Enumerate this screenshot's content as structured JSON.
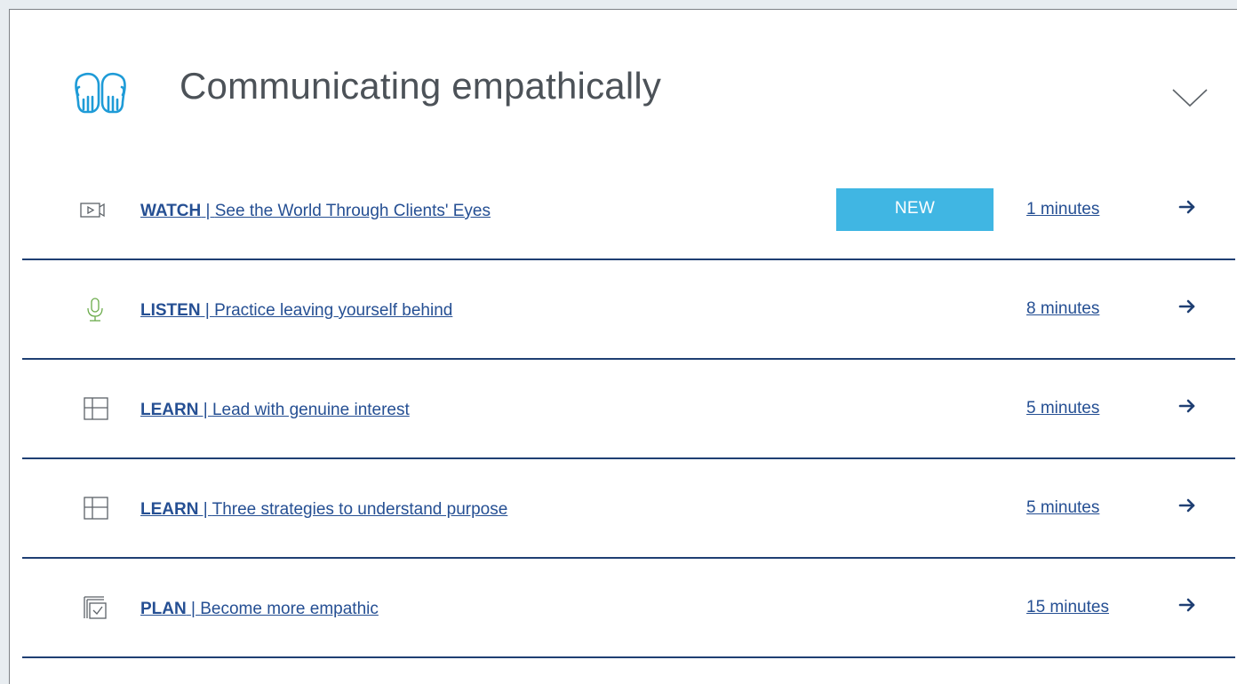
{
  "section": {
    "title": "Communicating empathically",
    "icon": "open-hands-icon",
    "collapse_icon": "chevron-down-icon",
    "accent_color": "#1e9bd7",
    "link_color": "#254f93",
    "badge_color": "#40b6e3",
    "divider_color": "#1f3f73"
  },
  "items": [
    {
      "icon": "video-camera-icon",
      "kind": "WATCH",
      "separator": " | ",
      "title": "See the World Through Clients' Eyes",
      "badge": "NEW",
      "duration": "1 minutes",
      "arrow_icon": "arrow-right-icon"
    },
    {
      "icon": "microphone-icon",
      "kind": "LISTEN",
      "separator": " | ",
      "title": "Practice leaving yourself behind",
      "duration": "8 minutes",
      "arrow_icon": "arrow-right-icon"
    },
    {
      "icon": "layout-grid-icon",
      "kind": "LEARN",
      "separator": " | ",
      "title": "Lead with genuine interest",
      "duration": "5 minutes",
      "arrow_icon": "arrow-right-icon"
    },
    {
      "icon": "layout-grid-icon",
      "kind": "LEARN",
      "separator": " | ",
      "title": "Three strategies to understand purpose",
      "duration": "5 minutes",
      "arrow_icon": "arrow-right-icon"
    },
    {
      "icon": "checklist-icon",
      "kind": "PLAN",
      "separator": " | ",
      "title": "Become more empathic",
      "duration": "15 minutes",
      "arrow_icon": "arrow-right-icon"
    }
  ]
}
